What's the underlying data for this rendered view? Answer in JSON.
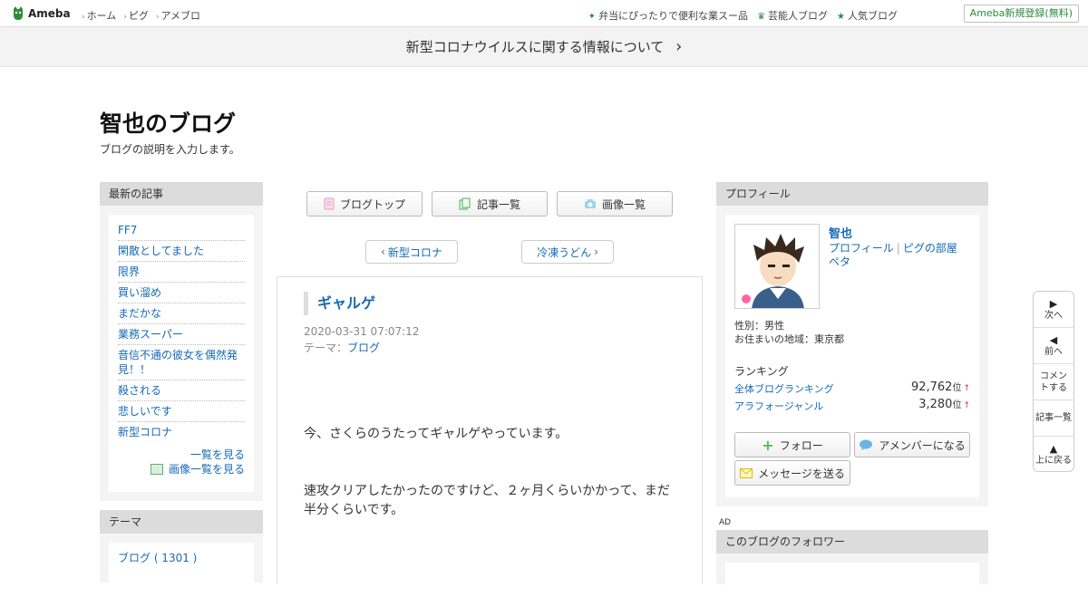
{
  "topbar": {
    "logo": "Ameba",
    "nav": [
      "ホーム",
      "ピグ",
      "アメブロ"
    ],
    "links": [
      {
        "icon": "sparkle-icon",
        "label": "弁当にぴったりで便利な業スー品"
      },
      {
        "icon": "crown-icon",
        "label": "芸能人ブログ"
      },
      {
        "icon": "star-icon",
        "label": "人気ブログ"
      }
    ],
    "register": "Ameba新規登録(無料)"
  },
  "notice": {
    "text": "新型コロナウイルスに関する情報について",
    "arrow": "›"
  },
  "blog": {
    "title": "智也のブログ",
    "description": "ブログの説明を入力します。"
  },
  "sidebar": {
    "recent_heading": "最新の記事",
    "recent_items": [
      "FF7",
      "閑散としてました",
      "限界",
      "買い溜め",
      "まだかな",
      "業務スーパー",
      "音信不通の彼女を偶然発見！！",
      "殺される",
      "悲しいです",
      "新型コロナ"
    ],
    "see_all": "一覧を見る",
    "see_images": "画像一覧を見る",
    "theme_heading": "テーマ",
    "theme_items": [
      "ブログ ( 1301 )"
    ]
  },
  "center": {
    "buttons": [
      "ブログトップ",
      "記事一覧",
      "画像一覧"
    ],
    "prev_label": "新型コロナ",
    "next_label": "冷凍うどん"
  },
  "article": {
    "title": "ギャルゲ",
    "date": "2020-03-31 07:07:12",
    "theme_prefix": "テーマ：",
    "theme": "ブログ",
    "paragraphs": [
      "今、さくらのうたってギャルゲやっています。",
      "速攻クリアしたかったのですけど、２ヶ月くらいかかって、まだ半分くらいです。"
    ]
  },
  "profile": {
    "heading": "プロフィール",
    "name": "智也",
    "link_profile": "プロフィール",
    "link_room": "ピグの部屋",
    "link_peta": "ペタ",
    "gender": "性別：男性",
    "location": "お住まいの地域：東京都",
    "ranking_heading": "ランキング",
    "rankings": [
      {
        "label": "全体ブログランキング",
        "value": "92,762",
        "unit": "位",
        "trend": "↑"
      },
      {
        "label": "アラフォージャンル",
        "value": "3,280",
        "unit": "位",
        "trend": "↑"
      }
    ],
    "follow": "フォロー",
    "amember": "アメンバーになる",
    "message": "メッセージを送る"
  },
  "ad_label": "AD",
  "followers_heading": "このブログのフォロワー",
  "floatnav": [
    {
      "glyph": "▶",
      "label": "次へ"
    },
    {
      "glyph": "◀",
      "label": "前へ"
    },
    {
      "glyph": "",
      "label": "コメントする"
    },
    {
      "glyph": "",
      "label": "記事一覧"
    },
    {
      "glyph": "▲",
      "label": "上に戻る"
    }
  ],
  "colors": {
    "link": "#1669b5",
    "brand_green": "#2d8c3c",
    "side_header": "#dcdcdc"
  }
}
